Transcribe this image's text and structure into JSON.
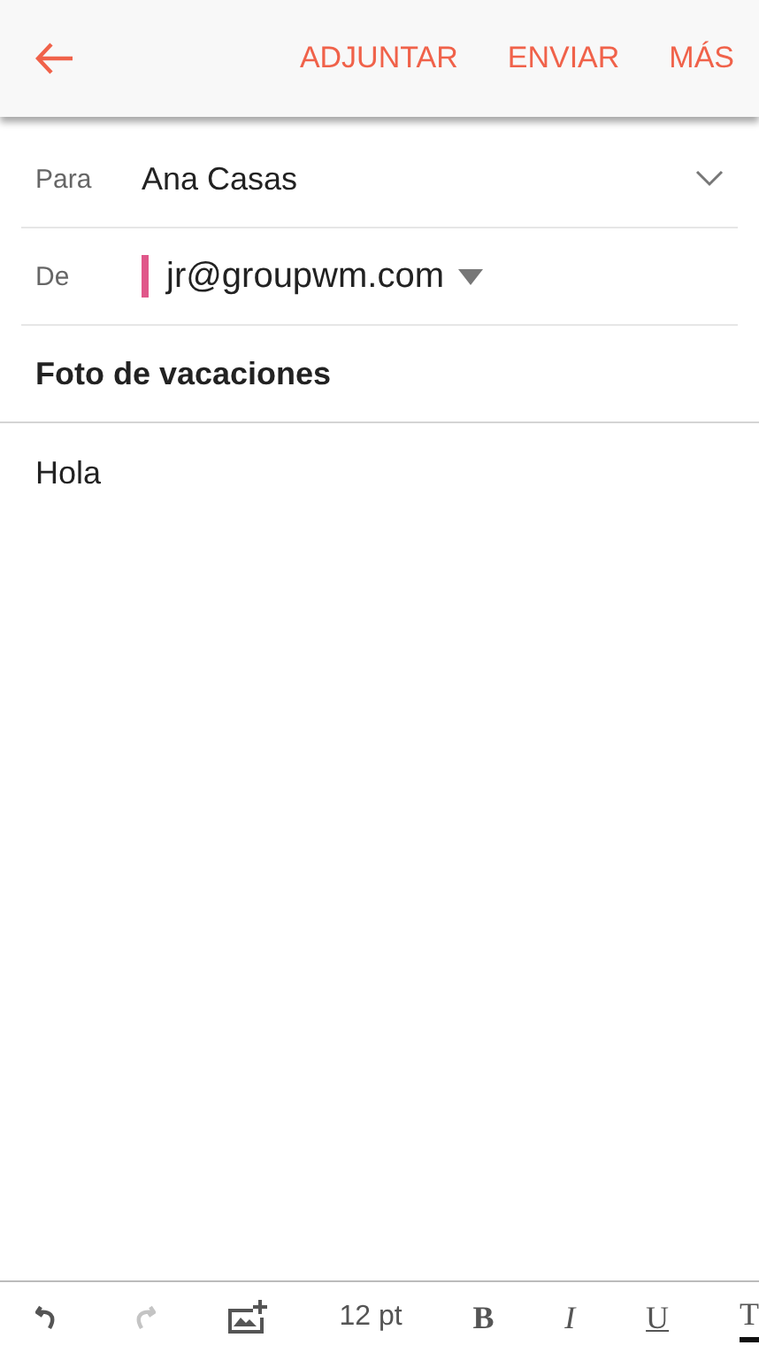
{
  "app_bar": {
    "actions": [
      "ADJUNTAR",
      "ENVIAR",
      "MÁS"
    ]
  },
  "to": {
    "label": "Para",
    "value": "Ana Casas"
  },
  "from": {
    "label": "De",
    "value": "jr@groupwm.com",
    "color": "#e0578a"
  },
  "subject": "Foto de vacaciones",
  "body": "Hola",
  "toolbar": [
    {
      "kind": "undo",
      "disabled": false
    },
    {
      "kind": "redo",
      "disabled": true
    },
    {
      "kind": "image",
      "disabled": false
    },
    {
      "kind": "size",
      "text": "12 pt",
      "disabled": false
    },
    {
      "kind": "bold",
      "text": "B",
      "disabled": false
    },
    {
      "kind": "italic",
      "text": "I",
      "disabled": false
    },
    {
      "kind": "underline",
      "text": "U",
      "disabled": false
    },
    {
      "kind": "color",
      "text": "T",
      "disabled": false
    }
  ]
}
